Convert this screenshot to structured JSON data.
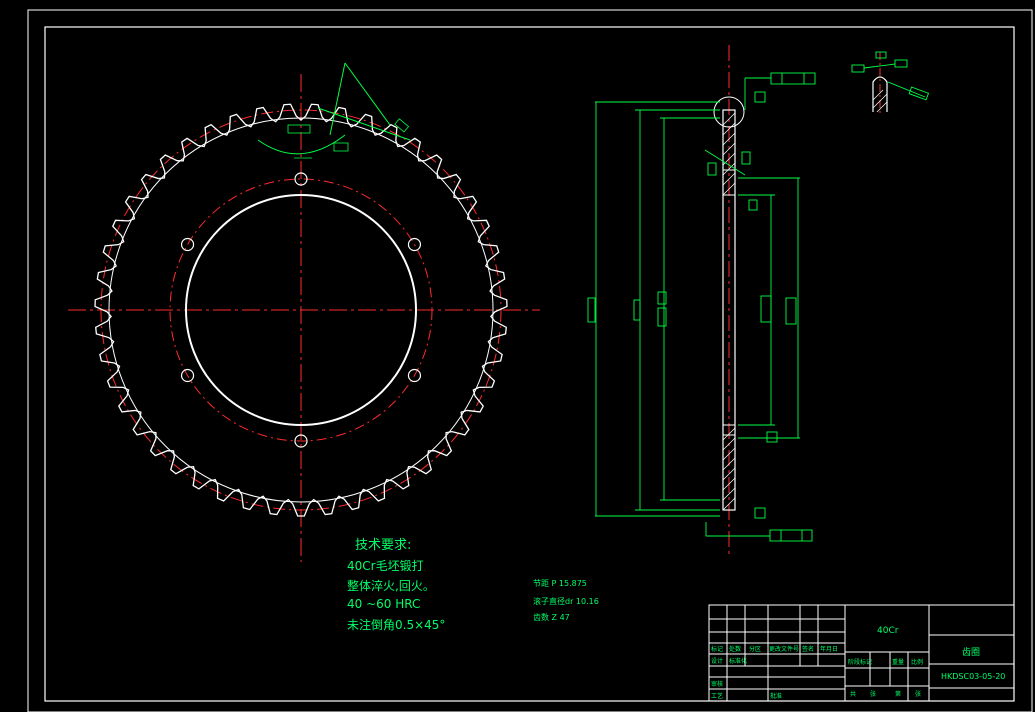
{
  "colors": {
    "background": "#000000",
    "border": "#ffffff",
    "outline": "#ffffff",
    "centerline": "#ff2a2a",
    "dimension": "#00ff44",
    "text": "#00ff66"
  },
  "sprocket": {
    "tooth_count": 47,
    "bolt_hole_count": 6
  },
  "technical_requirements": {
    "title": "技术要求:",
    "lines": [
      "40Cr毛坯锻打",
      "整体淬火,回火。",
      "40 ~60 HRC",
      "未注倒角0.5×45°"
    ]
  },
  "parameters": {
    "pitch": "节距 P 15.875",
    "roller": "滚子直径dr 10.16",
    "teeth": "齿数 Z 47"
  },
  "title_block": {
    "material": "40Cr",
    "part_name": "齿圈",
    "drawing_number": "HKDSC03-05-20",
    "labels": [
      "标记",
      "处数",
      "分区",
      "更改文件号",
      "签名",
      "年月日",
      "设计",
      "标准化",
      "审核",
      "工艺",
      "批准",
      "阶段标记",
      "重量",
      "比例",
      "共",
      "张",
      "第",
      "张"
    ]
  }
}
